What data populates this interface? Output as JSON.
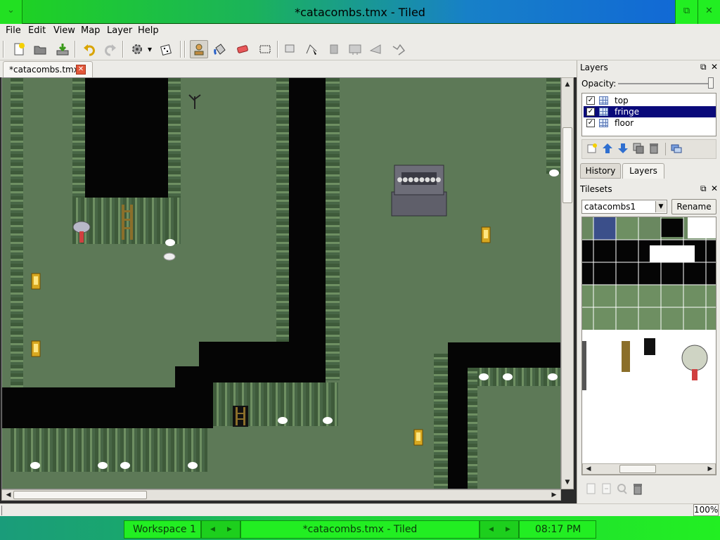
{
  "window": {
    "title": "*catacombs.tmx - Tiled",
    "menu_icon": "menu-icon",
    "maximize_icon": "restore-icon",
    "close_icon": "close-icon"
  },
  "menu": [
    "File",
    "Edit",
    "View",
    "Map",
    "Layer",
    "Help"
  ],
  "toolbar": {
    "buttons": [
      "new-file-icon",
      "open-icon",
      "save-icon",
      "undo-icon",
      "redo-icon",
      "command-icon",
      "random-icon",
      "stamp-brush-icon",
      "bucket-fill-icon",
      "eraser-icon",
      "rect-select-icon",
      "object-select-icon",
      "edit-polygon-icon",
      "insert-rect-icon",
      "insert-image-icon",
      "insert-polygon-icon",
      "insert-polyline-icon"
    ],
    "active_tool": "stamp-brush-icon"
  },
  "document_tab": {
    "label": "*catacombs.tmx"
  },
  "layers_panel": {
    "title": "Layers",
    "opacity_label": "Opacity:",
    "opacity_value": 1.0,
    "layers": [
      {
        "name": "top",
        "visible": true,
        "selected": false
      },
      {
        "name": "fringe",
        "visible": true,
        "selected": true
      },
      {
        "name": "floor",
        "visible": true,
        "selected": false
      }
    ],
    "tabs": [
      "History",
      "Layers"
    ],
    "active_tab": "Layers"
  },
  "tilesets_panel": {
    "title": "Tilesets",
    "selected_tileset": "catacombs1",
    "rename_label": "Rename"
  },
  "status": {
    "zoom": "100%"
  },
  "taskbar": {
    "workspace": "Workspace 1",
    "window_title": "*catacombs.tmx - Tiled",
    "clock": "08:17 PM"
  },
  "colors": {
    "floor": "#5d7957",
    "wall": "#050505",
    "selection": "#0a0a7a",
    "title_gradient_start": "#1fd41f",
    "title_gradient_end": "#1064d8"
  }
}
